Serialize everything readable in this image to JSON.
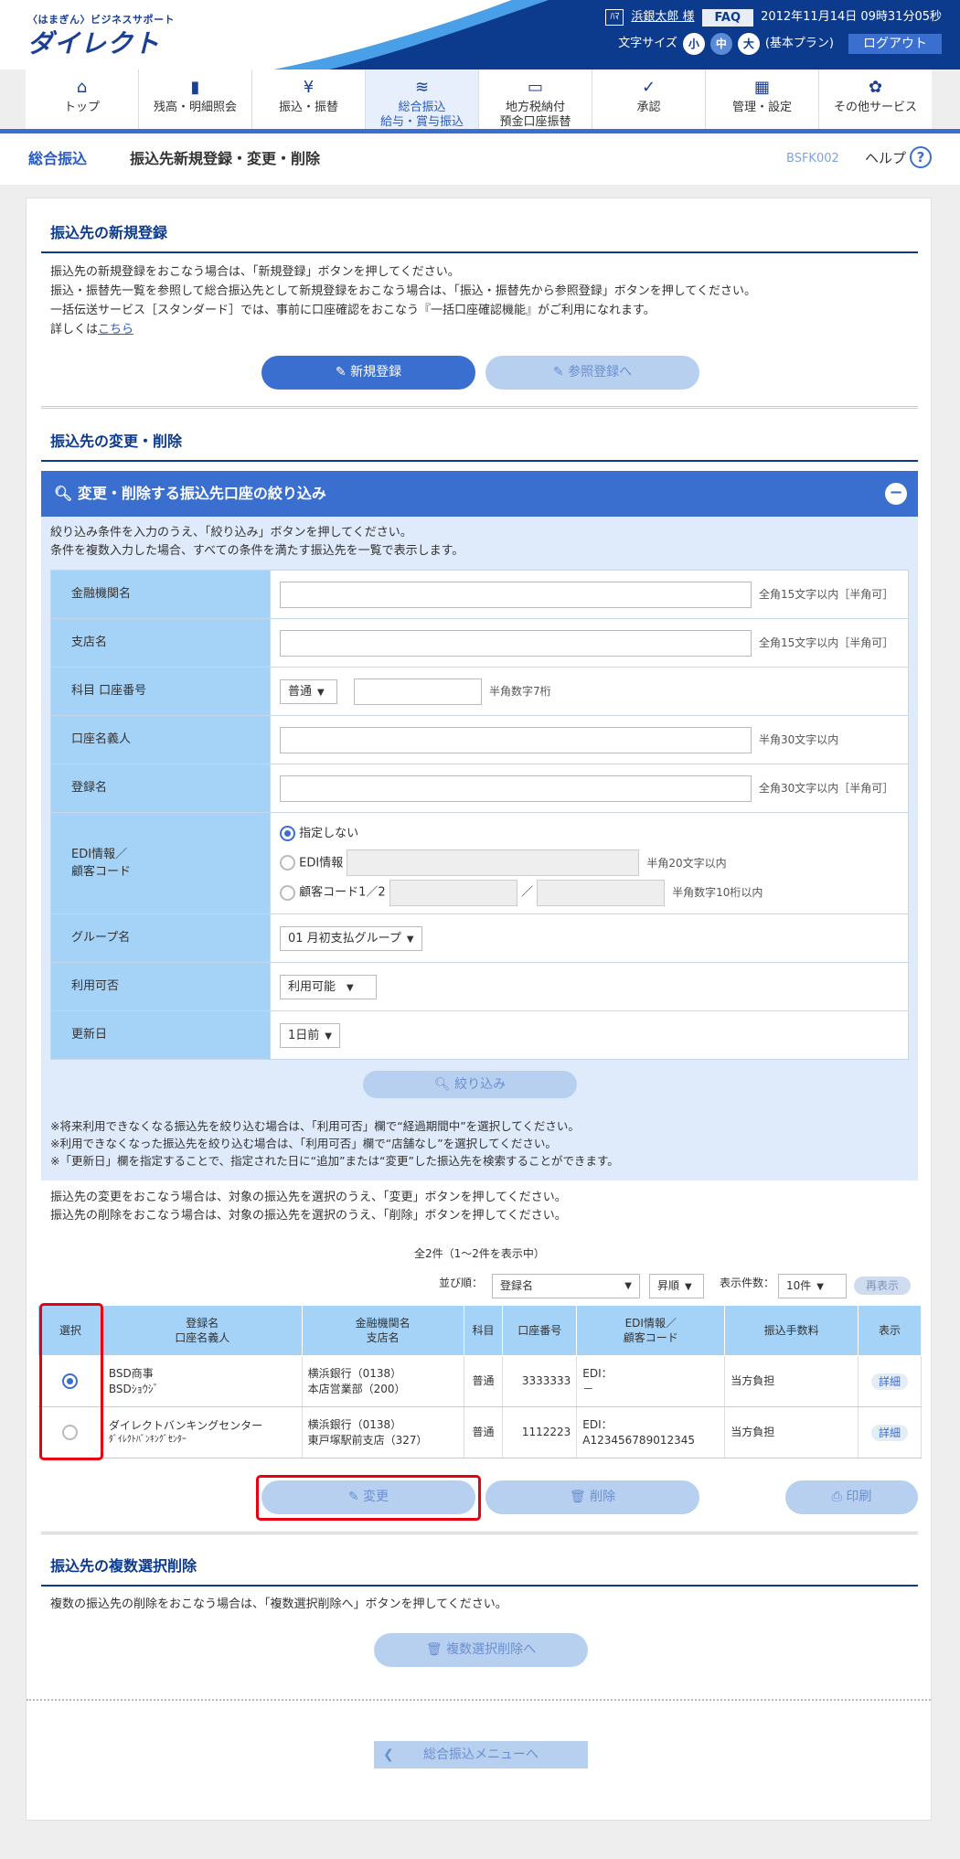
{
  "header": {
    "logo_small": "〈はまぎん〉ビジネスサポート",
    "logo_main": "ダイレクト",
    "user": "浜銀太郎 様",
    "faq": "FAQ",
    "datetime": "2012年11月14日 09時31分05秒",
    "font_size_label": "文字サイズ",
    "size_small": "小",
    "size_mid": "中",
    "size_large": "大",
    "plan": "(基本プラン)",
    "logout": "ログアウト"
  },
  "nav": [
    "トップ",
    "残高・明細照会",
    "振込・振替",
    "総合振込\n給与・賞与振込",
    "地方税納付\n預金口座振替",
    "承認",
    "管理・設定",
    "その他サービス"
  ],
  "subheader": {
    "category": "総合振込",
    "page_title": "振込先新規登録・変更・削除",
    "screen_id": "BSFK002",
    "help": "ヘルプ"
  },
  "new_reg": {
    "title": "振込先の新規登録",
    "lines": [
      "振込先の新規登録をおこなう場合は、「新規登録」ボタンを押してください。",
      "振込・振替先一覧を参照して総合振込先として新規登録をおこなう場合は、「振込・振替先から参照登録」ボタンを押してください。",
      "一括伝送サービス［スタンダード］では、事前に口座確認をおこなう『一括口座確認機能』がご利用になれます。"
    ],
    "detail_prefix": "詳しくは",
    "detail_link": "こちら",
    "btn_new": "新規登録",
    "btn_ref": "参照登録へ"
  },
  "change": {
    "title": "振込先の変更・削除",
    "filter_title": "変更・削除する振込先口座の絞り込み",
    "filter_desc1": "絞り込み条件を入力のうえ、「絞り込み」ボタンを押してください。",
    "filter_desc2": "条件を複数入力した場合、すべての条件を満たす振込先を一覧で表示します。",
    "f_bank": "金融機関名",
    "f_bank_note": "全角15文字以内［半角可］",
    "f_branch": "支店名",
    "f_branch_note": "全角15文字以内［半角可］",
    "f_account": "科目 口座番号",
    "f_account_type": "普通",
    "f_account_note": "半角数字7桁",
    "f_holder": "口座名義人",
    "f_holder_note": "半角30文字以内",
    "f_regname": "登録名",
    "f_regname_note": "全角30文字以内［半角可］",
    "f_edi": "EDI情報／\n顧客コード",
    "f_edi_opt1": "指定しない",
    "f_edi_opt2": "EDI情報",
    "f_edi_opt2_note": "半角20文字以内",
    "f_edi_opt3": "顧客コード1／2",
    "f_edi_sep": "／",
    "f_edi_opt3_note": "半角数字10桁以内",
    "f_group": "グループ名",
    "f_group_val": "01 月初支払グループ",
    "f_avail": "利用可否",
    "f_avail_val": "利用可能",
    "f_update": "更新日",
    "f_update_val": "1日前",
    "btn_filter": "絞り込み",
    "notes": [
      "※将来利用できなくなる振込先を絞り込む場合は、「利用可否」欄で“経過期間中”を選択してください。",
      "※利用できなくなった振込先を絞り込む場合は、「利用可否」欄で“店舗なし”を選択してください。",
      "※「更新日」欄を指定することで、指定された日に“追加”または“変更”した振込先を検索することができます。"
    ],
    "instr1": "振込先の変更をおこなう場合は、対象の振込先を選択のうえ、「変更」ボタンを押してください。",
    "instr2": "振込先の削除をおこなう場合は、対象の振込先を選択のうえ、「削除」ボタンを押してください。",
    "count": "全2件（1～2件を表示中）",
    "sort_label": "並び順：",
    "sort_val": "登録名",
    "order_val": "昇順",
    "per_label": "表示件数：",
    "per_val": "10件",
    "redisplay": "再表示",
    "columns": [
      "選択",
      "登録名\n口座名義人",
      "金融機関名\n支店名",
      "科目",
      "口座番号",
      "EDI情報／\n顧客コード",
      "振込手数料",
      "表示"
    ],
    "rows": [
      {
        "name": "BSD商事",
        "kana": "BSDｼｮｳｼﾞ",
        "bank": "横浜銀行（0138）",
        "branch": "本店営業部（200）",
        "type": "普通",
        "acct": "3333333",
        "edi1": "EDI：",
        "edi2": "－",
        "fee": "当方負担",
        "detail": "詳細",
        "selected": true
      },
      {
        "name": "ダイレクトバンキングセンター",
        "kana": "ﾀﾞｲﾚｸﾄﾊﾞﾝｷﾝｸﾞｾﾝﾀｰ",
        "bank": "横浜銀行（0138）",
        "branch": "東戸塚駅前支店（327）",
        "type": "普通",
        "acct": "1112223",
        "edi1": "EDI：",
        "edi2": "A123456789012345",
        "fee": "当方負担",
        "detail": "詳細",
        "selected": false
      }
    ],
    "btn_change": "変更",
    "btn_delete": "削除",
    "btn_print": "印刷"
  },
  "multi": {
    "title": "振込先の複数選択削除",
    "desc": "複数の振込先の削除をおこなう場合は、「複数選択削除へ」ボタンを押してください。",
    "btn": "複数選択削除へ"
  },
  "footer": {
    "back": "総合振込メニューへ"
  }
}
